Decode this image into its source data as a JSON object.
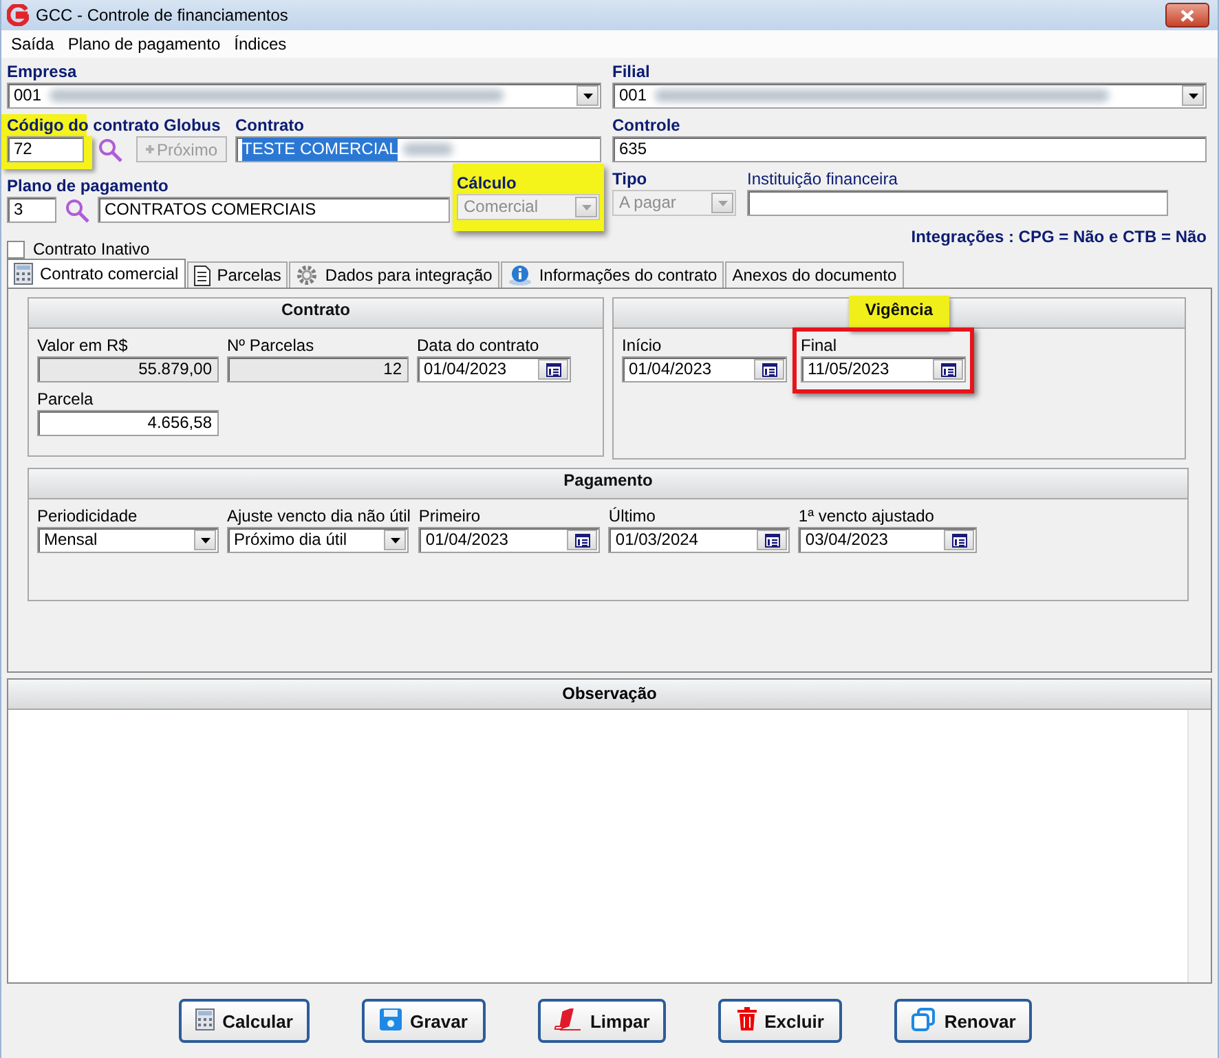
{
  "window": {
    "title": "GCC - Controle de financiamentos"
  },
  "menu": [
    "Saída",
    "Plano de pagamento",
    "Índices"
  ],
  "header": {
    "empresa": {
      "label": "Empresa",
      "value": "001",
      "redacted": true
    },
    "codigo": {
      "label": "Código do contrato Globus",
      "value": "72",
      "highlighted": true
    },
    "next_button": {
      "label": "Próximo",
      "disabled": true
    },
    "contrato": {
      "label": "Contrato",
      "value": "TESTE COMERCIAL",
      "selected": true,
      "redacted": true
    },
    "plano": {
      "label": "Plano de pagamento",
      "code": "3",
      "value": "CONTRATOS COMERCIAIS"
    },
    "calculo": {
      "label": "Cálculo",
      "value": "Comercial",
      "disabled": true,
      "highlighted": true
    },
    "inativo": {
      "label": "Contrato Inativo",
      "checked": false
    },
    "filial": {
      "label": "Filial",
      "value": "001",
      "redacted": true
    },
    "controle": {
      "label": "Controle",
      "value": "635"
    },
    "tipo": {
      "label": "Tipo",
      "value": "A pagar",
      "disabled": true
    },
    "instituicao": {
      "label": "Instituição financeira"
    },
    "integracoes": "Integrações : CPG = Não e CTB = Não"
  },
  "tabs": [
    {
      "label": "Contrato comercial",
      "selected": true
    },
    {
      "label": "Parcelas",
      "selected": false
    },
    {
      "label": "Dados para integração",
      "selected": false
    },
    {
      "label": "Informações do contrato",
      "selected": false
    },
    {
      "label": "Anexos do documento",
      "selected": false
    }
  ],
  "groups": [
    {
      "title": "Contrato",
      "highlighted": false,
      "fields": [
        {
          "label": "Valor em R$",
          "value": "55.879,00",
          "kind": "readonly"
        },
        {
          "label": "Nº Parcelas",
          "value": "12",
          "kind": "readonly"
        },
        {
          "label": "Data do contrato",
          "value": "01/04/2023",
          "kind": "date"
        },
        {
          "label": "Parcela",
          "value": "4.656,58",
          "kind": "number"
        }
      ]
    },
    {
      "title": "Vigência",
      "highlighted": true,
      "fields": [
        {
          "label": "Início",
          "value": "01/04/2023",
          "kind": "date",
          "marked": false
        },
        {
          "label": "Final",
          "value": "11/05/2023",
          "kind": "date",
          "marked": true
        }
      ]
    },
    {
      "title": "Pagamento",
      "highlighted": false,
      "fields": [
        {
          "label": "Periodicidade",
          "value": "Mensal",
          "kind": "combo"
        },
        {
          "label": "Ajuste vencto dia não útil",
          "value": "Próximo dia útil",
          "kind": "combo"
        },
        {
          "label": "Primeiro",
          "value": "01/04/2023",
          "kind": "date"
        },
        {
          "label": "Último",
          "value": "01/03/2024",
          "kind": "date"
        },
        {
          "label": "1ª vencto ajustado",
          "value": "03/04/2023",
          "kind": "date"
        }
      ]
    }
  ],
  "observacao": {
    "title": "Observação"
  },
  "buttons": [
    {
      "label": "Calcular"
    },
    {
      "label": "Gravar"
    },
    {
      "label": "Limpar"
    },
    {
      "label": "Excluir"
    },
    {
      "label": "Renovar"
    }
  ]
}
